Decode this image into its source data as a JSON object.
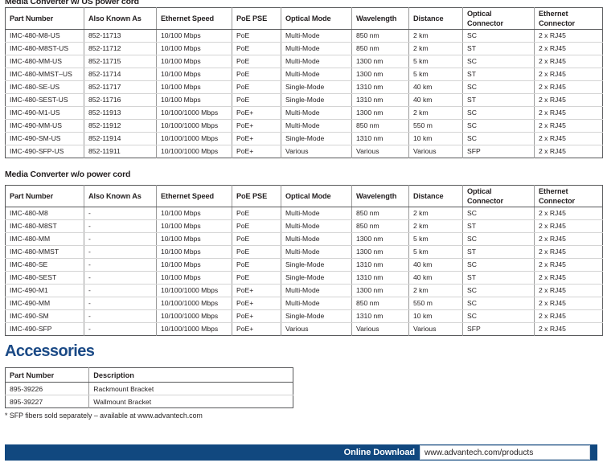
{
  "sections": {
    "us_table_heading": "Media Converter w/ US power cord",
    "no_cord_table_heading": "Media Converter w/o power cord",
    "accessories_heading": "Accessories"
  },
  "spec_columns": [
    "Part Number",
    "Also Known As",
    "Ethernet Speed",
    "PoE PSE",
    "Optical Mode",
    "Wavelength",
    "Distance",
    "Optical Connector",
    "Ethernet Connector"
  ],
  "spec_columns_lines": {
    "optical_connector_1": "Optical",
    "optical_connector_2": "Connector",
    "ethernet_connector_1": "Ethernet",
    "ethernet_connector_2": "Connector"
  },
  "us_table_rows": [
    [
      "IMC-480-M8-US",
      "852-11713",
      "10/100 Mbps",
      "PoE",
      "Multi-Mode",
      "850 nm",
      "2 km",
      "SC",
      "2 x RJ45"
    ],
    [
      "IMC-480-M8ST-US",
      "852-11712",
      "10/100 Mbps",
      "PoE",
      "Multi-Mode",
      "850 nm",
      "2 km",
      "ST",
      "2 x RJ45"
    ],
    [
      "IMC-480-MM-US",
      "852-11715",
      "10/100 Mbps",
      "PoE",
      "Multi-Mode",
      "1300 nm",
      "5 km",
      "SC",
      "2 x RJ45"
    ],
    [
      "IMC-480-MMST–US",
      "852-11714",
      "10/100 Mbps",
      "PoE",
      "Multi-Mode",
      "1300 nm",
      "5 km",
      "ST",
      "2 x RJ45"
    ],
    [
      "IMC-480-SE-US",
      "852-11717",
      "10/100 Mbps",
      "PoE",
      "Single-Mode",
      "1310 nm",
      "40 km",
      "SC",
      "2 x RJ45"
    ],
    [
      "IMC-480-SEST-US",
      "852-11716",
      "10/100 Mbps",
      "PoE",
      "Single-Mode",
      "1310 nm",
      "40 km",
      "ST",
      "2 x RJ45"
    ],
    [
      "IMC-490-M1-US",
      "852-11913",
      "10/100/1000 Mbps",
      "PoE+",
      "Multi-Mode",
      "1300 nm",
      "2 km",
      "SC",
      "2 x RJ45"
    ],
    [
      "IMC-490-MM-US",
      "852-11912",
      "10/100/1000 Mbps",
      "PoE+",
      "Multi-Mode",
      "850 nm",
      "550 m",
      "SC",
      "2 x RJ45"
    ],
    [
      "IMC-490-SM-US",
      "852-11914",
      "10/100/1000 Mbps",
      "PoE+",
      "Single-Mode",
      "1310 nm",
      "10 km",
      "SC",
      "2 x RJ45"
    ],
    [
      "IMC-490-SFP-US",
      "852-11911",
      "10/100/1000 Mbps",
      "PoE+",
      "Various",
      "Various",
      "Various",
      "SFP",
      "2 x RJ45"
    ]
  ],
  "no_cord_table_rows": [
    [
      "IMC-480-M8",
      "-",
      "10/100 Mbps",
      "PoE",
      "Multi-Mode",
      "850 nm",
      "2 km",
      "SC",
      "2 x RJ45"
    ],
    [
      "IMC-480-M8ST",
      "-",
      "10/100 Mbps",
      "PoE",
      "Multi-Mode",
      "850 nm",
      "2 km",
      "ST",
      "2 x RJ45"
    ],
    [
      "IMC-480-MM",
      "-",
      "10/100 Mbps",
      "PoE",
      "Multi-Mode",
      "1300 nm",
      "5 km",
      "SC",
      "2 x RJ45"
    ],
    [
      "IMC-480-MMST",
      "-",
      "10/100 Mbps",
      "PoE",
      "Multi-Mode",
      "1300 nm",
      "5 km",
      "ST",
      "2 x RJ45"
    ],
    [
      "IMC-480-SE",
      "-",
      "10/100 Mbps",
      "PoE",
      "Single-Mode",
      "1310 nm",
      "40 km",
      "SC",
      "2 x RJ45"
    ],
    [
      "IMC-480-SEST",
      "-",
      "10/100 Mbps",
      "PoE",
      "Single-Mode",
      "1310 nm",
      "40 km",
      "ST",
      "2 x RJ45"
    ],
    [
      "IMC-490-M1",
      "-",
      "10/100/1000 Mbps",
      "PoE+",
      "Multi-Mode",
      "1300 nm",
      "2 km",
      "SC",
      "2 x RJ45"
    ],
    [
      "IMC-490-MM",
      "-",
      "10/100/1000 Mbps",
      "PoE+",
      "Multi-Mode",
      "850 nm",
      "550 m",
      "SC",
      "2 x RJ45"
    ],
    [
      "IMC-490-SM",
      "-",
      "10/100/1000 Mbps",
      "PoE+",
      "Single-Mode",
      "1310 nm",
      "10 km",
      "SC",
      "2 x RJ45"
    ],
    [
      "IMC-490-SFP",
      "-",
      "10/100/1000 Mbps",
      "PoE+",
      "Various",
      "Various",
      "Various",
      "SFP",
      "2 x RJ45"
    ]
  ],
  "accessories_columns": [
    "Part Number",
    "Description"
  ],
  "accessories_rows": [
    [
      "895-39226",
      "Rackmount Bracket"
    ],
    [
      "895-39227",
      "Wallmount Bracket"
    ]
  ],
  "footnote": "* SFP fibers sold separately – available at www.advantech.com",
  "footer": {
    "label": "Online Download",
    "url": "www.advantech.com/products"
  },
  "colors": {
    "brand_blue": "#1b4a86",
    "footer_bar": "#11487f",
    "text": "#231f20",
    "grid_line": "#d4d4d4",
    "border": "#58595b"
  }
}
